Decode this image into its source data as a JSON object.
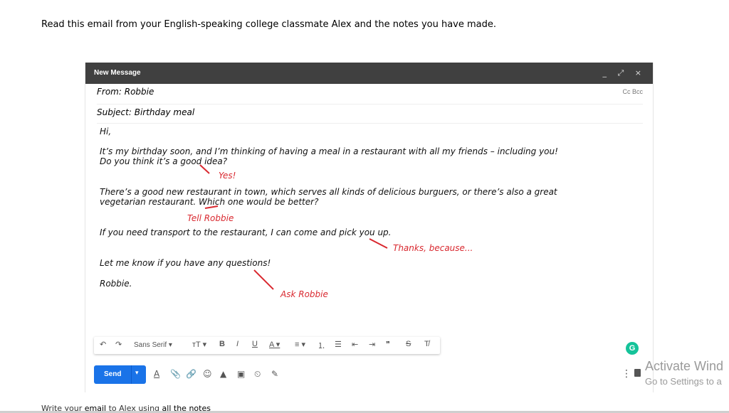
{
  "instruction": "Read this email from your English-speaking college classmate Alex and the notes you have made.",
  "compose": {
    "window_title": "New Message",
    "window_controls": "_ ⤢ ×",
    "from": "From: Robbie",
    "cc_bcc": "Cc Bcc",
    "subject": "Subject: Birthday meal",
    "body_lines": [
      "Hi,",
      "It’s my birthday soon, and I’m thinking of having a meal in a restaurant with all my friends – including you!",
      "Do you think it’s a good idea?",
      "There’s a good new restaurant in town, which serves all kinds of delicious burguers, or there’s also a great",
      "vegetarian restaurant. Which one would be better?",
      "If you need transport to the restaurant, I can come and pick you up.",
      "Let me know if you have any questions!",
      "Robbie."
    ],
    "notes": [
      "Yes!",
      "Tell Robbie",
      "Thanks, because...",
      "Ask Robbie"
    ],
    "toolbar": {
      "undo": "↶",
      "redo": "↷",
      "font": "Sans Serif ▾",
      "size": "ᴛT ▾",
      "bold": "B",
      "italic": "I",
      "underline": "U",
      "text_color": "A ▾",
      "align": "≡ ▾",
      "numbered_list": "⒈",
      "bulleted_list": "☰",
      "indent_less": "⇤",
      "indent_more": "⇥",
      "quote": "❞",
      "strikethrough": "S",
      "clear_format": "T̸"
    },
    "grammarly": "G",
    "send_label": "Send",
    "send_caret": "▾",
    "bottom_icons": {
      "formatting": "A",
      "attach": "📎",
      "link": "🔗",
      "emoji": "☺",
      "drive": "▲",
      "photo": "▣",
      "lock": "⏲",
      "signature": "✎",
      "more": "⋮"
    }
  },
  "footer": {
    "prefix": "Write your ",
    "email": "email",
    "middle": " to Alex using ",
    "notes": "all the notes"
  },
  "watermark": {
    "line1": "Activate Wind",
    "line2": "Go to Settings to a"
  },
  "colors": {
    "title_bar": "#404040",
    "send_button": "#1a73e8",
    "notes_red": "#d9282f",
    "grammarly": "#15c39a"
  }
}
